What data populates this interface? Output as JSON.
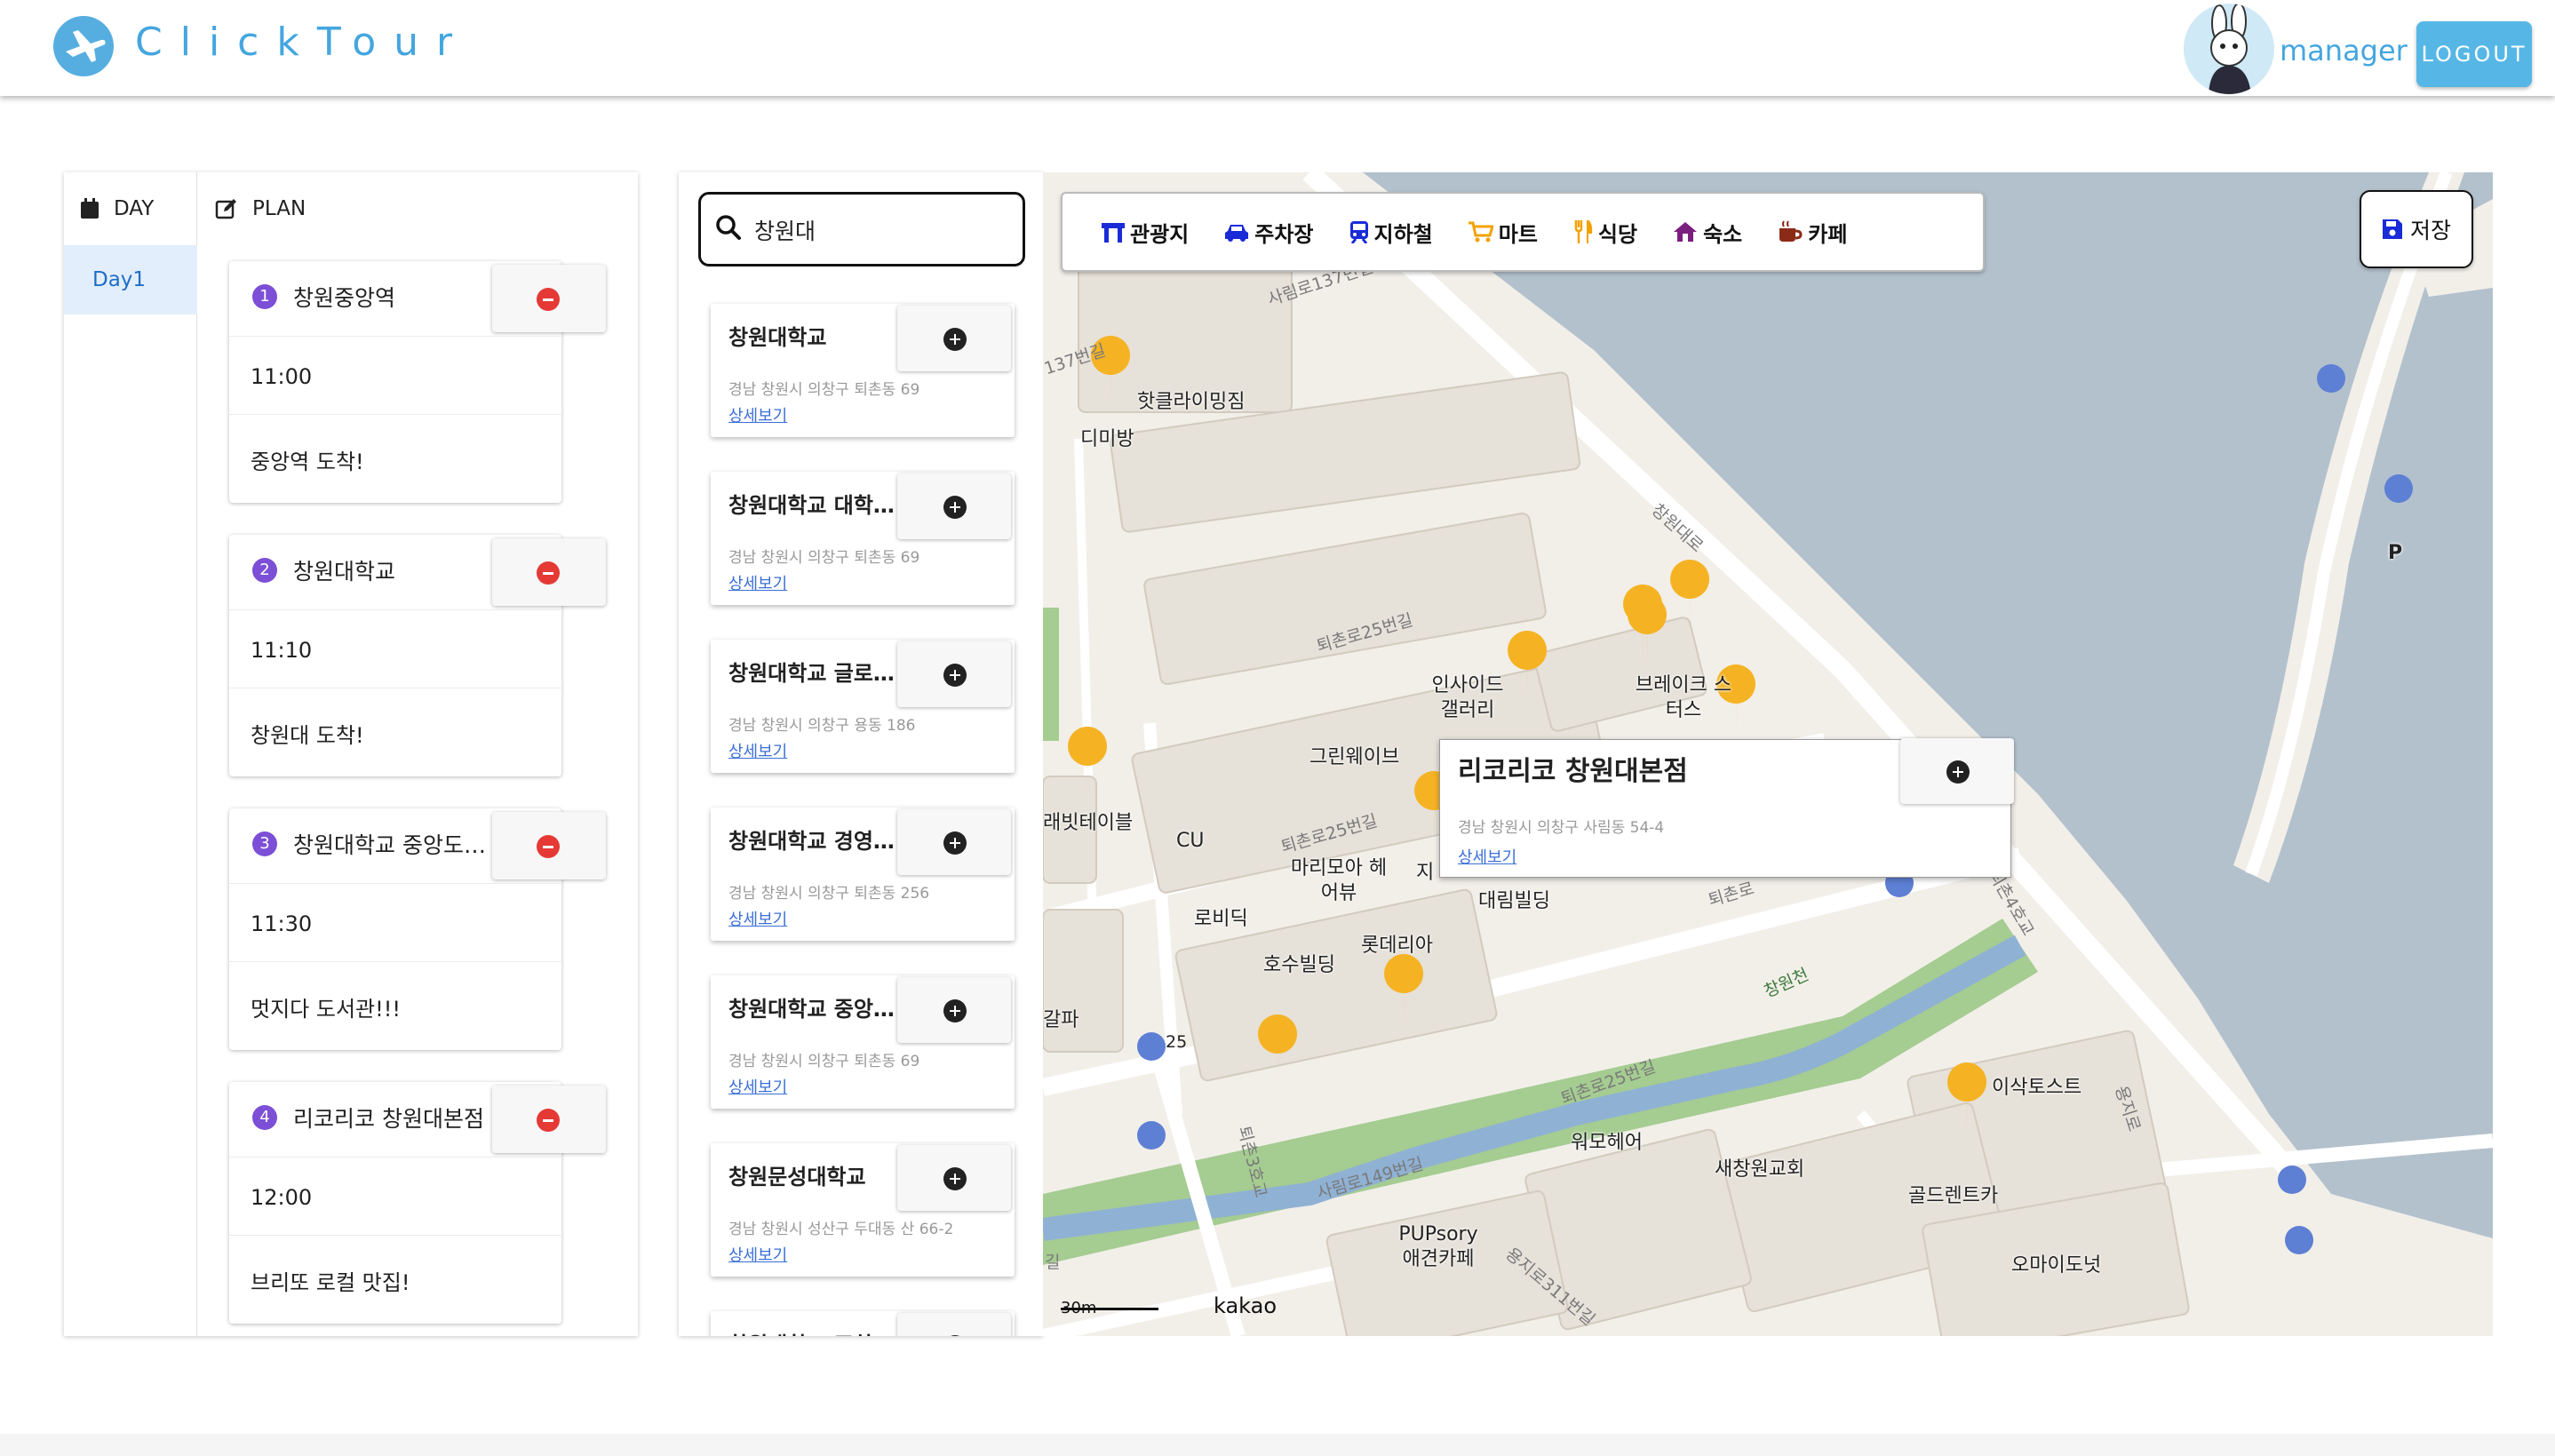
{
  "header": {
    "logo_text": "ClickTour",
    "username": "manager",
    "logout_label": "LOGOUT"
  },
  "plan": {
    "day_header": "DAY",
    "plan_header": "PLAN",
    "days": [
      "Day1"
    ],
    "items": [
      {
        "num": "1",
        "title": "창원중앙역",
        "time": "11:00",
        "memo": "중앙역 도착!"
      },
      {
        "num": "2",
        "title": "창원대학교",
        "time": "11:10",
        "memo": "창원대 도착!"
      },
      {
        "num": "3",
        "title": "창원대학교 중앙도…",
        "time": "11:30",
        "memo": "멋지다 도서관!!!"
      },
      {
        "num": "4",
        "title": "리코리코 창원대본점",
        "time": "12:00",
        "memo": "브리또 로컬 맛집!"
      }
    ]
  },
  "search": {
    "query": "창원대",
    "detail_link": "상세보기",
    "results": [
      {
        "title": "창원대학교",
        "address": "경남 창원시 의창구 퇴촌동 69"
      },
      {
        "title": "창원대학교 대학…",
        "address": "경남 창원시 의창구 퇴촌동 69"
      },
      {
        "title": "창원대학교 글로…",
        "address": "경남 창원시 의창구 용동 186"
      },
      {
        "title": "창원대학교 경영…",
        "address": "경남 창원시 의창구 퇴촌동 256"
      },
      {
        "title": "창원대학교 중앙…",
        "address": "경남 창원시 의창구 퇴촌동 69"
      },
      {
        "title": "창원문성대학교",
        "address": "경남 창원시 성산구 두대동 산 66-2"
      },
      {
        "title": "창원대학교 조차…",
        "address": ""
      }
    ]
  },
  "map": {
    "categories": [
      {
        "label": "관광지",
        "icon": "landmark-icon",
        "color": "#1a2bd8"
      },
      {
        "label": "주차장",
        "icon": "car-icon",
        "color": "#1a2bd8"
      },
      {
        "label": "지하철",
        "icon": "subway-icon",
        "color": "#1a2bd8"
      },
      {
        "label": "마트",
        "icon": "cart-icon",
        "color": "#f2a200"
      },
      {
        "label": "식당",
        "icon": "utensils-icon",
        "color": "#f2a200"
      },
      {
        "label": "숙소",
        "icon": "house-icon",
        "color": "#7b1f7e"
      },
      {
        "label": "카페",
        "icon": "coffee-icon",
        "color": "#8b2a17"
      }
    ],
    "save_label": "저장",
    "popup": {
      "title": "리코리코 창원대본점",
      "address": "경남 창원시 의창구 사림동 54-4",
      "link": "상세보기"
    },
    "place_labels": [
      "핫클라이밍짐",
      "디미방",
      "인사이드 갤러리",
      "브레이크 스터스",
      "그린웨이브",
      "래빗테이블",
      "CU",
      "마리모아 헤어뷰",
      "로비딕",
      "대림빌딩",
      "롯데리아",
      "호수빌딩",
      "갈파",
      "이삭토스트",
      "골드렌트카",
      "새창원교회",
      "워모헤어",
      "PUPsory 애견카페",
      "오마이도넛",
      "P",
      "지"
    ],
    "road_labels": [
      "사림로137번길",
      "퇴촌로25번길",
      "퇴촌로",
      "창원천",
      "사림로149번길",
      "퇴촌3호교",
      "퇴촌4호교",
      "창원대로",
      "용지로311번길",
      "퇴촌로25번길",
      "137번길",
      "퇴촌로25번길",
      "용지로",
      "길",
      "25"
    ],
    "scale": "30m",
    "brand": "kakao"
  },
  "colors": {
    "accent": "#45a6df",
    "marker": "#f5b324",
    "remove": "#e53935",
    "link": "#3b6fd8"
  }
}
